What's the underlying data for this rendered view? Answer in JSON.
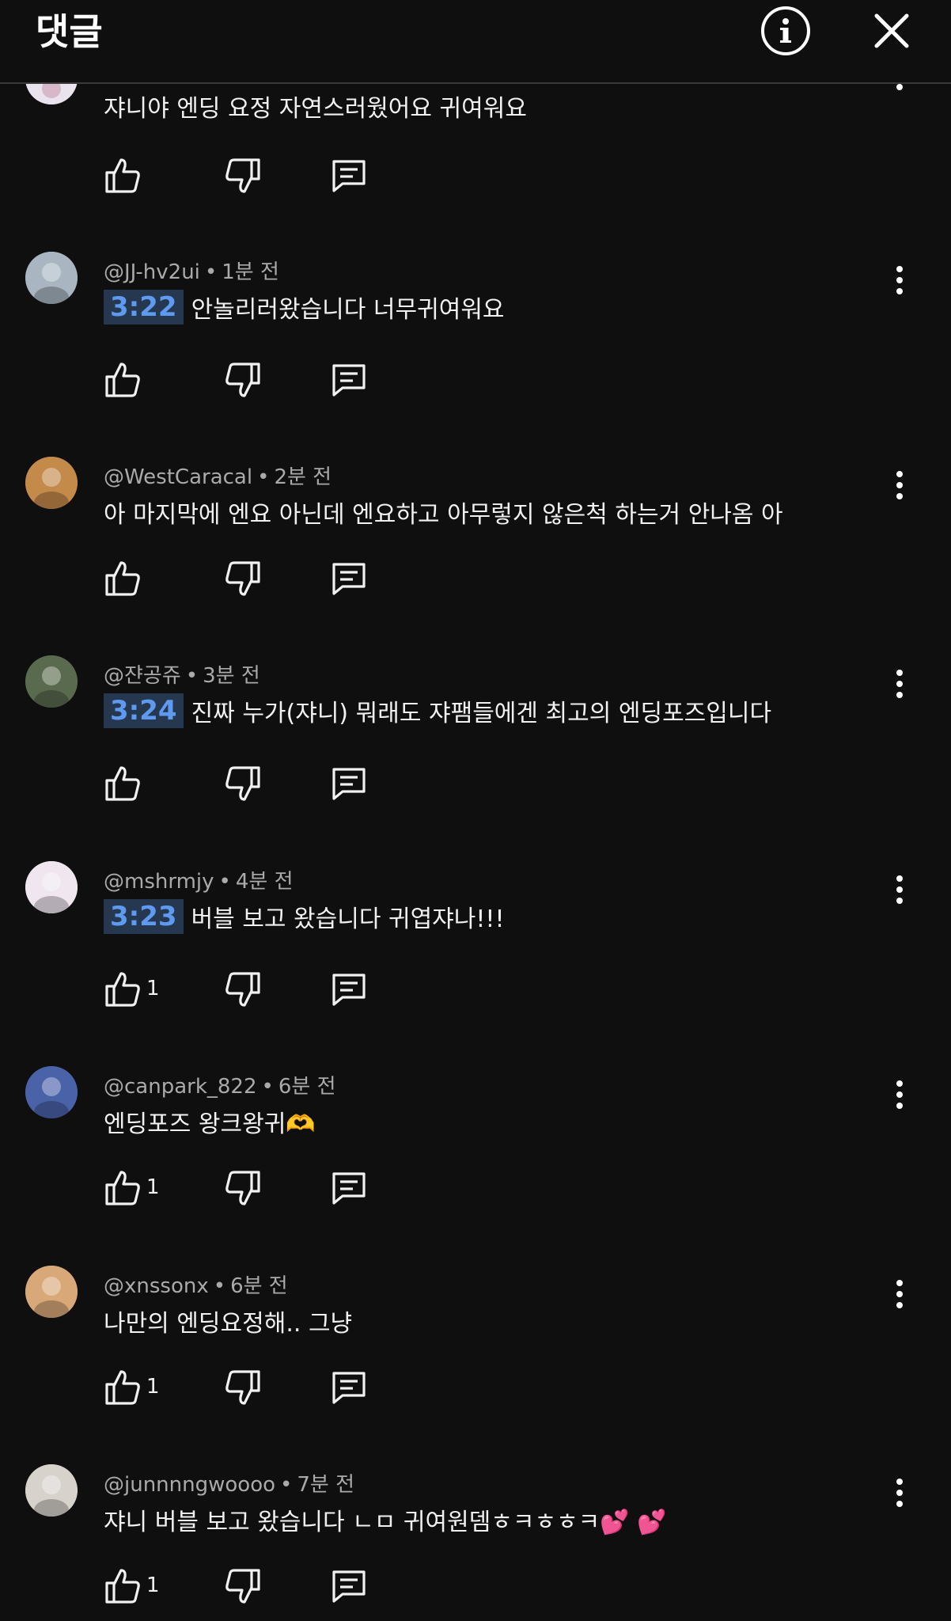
{
  "header": {
    "title": "댓글"
  },
  "top_partial": {
    "text": "쟈니야 엔딩 요정 자연스러웠어요 귀여워요"
  },
  "comments": [
    {
      "handle": "@JJ-hv2ui",
      "time": "1분 전",
      "timestamp": "3:22",
      "text": "안놀리러왔습니다 너무귀여워요",
      "likes": ""
    },
    {
      "handle": "@WestCaracal",
      "time": "2분 전",
      "timestamp": "",
      "text": "아 마지막에 엔요 아닌데 엔요하고 아무렇지 않은척 하는거 안나옴 아",
      "likes": ""
    },
    {
      "handle": "@쟌공쥬",
      "time": "3분 전",
      "timestamp": "3:24",
      "text": "진짜 누가(쟈니) 뭐래도 쟈팸들에겐 최고의 엔딩포즈입니다",
      "likes": ""
    },
    {
      "handle": "@mshrmjy",
      "time": "4분 전",
      "timestamp": "3:23",
      "text": "버블 보고 왔습니다 귀엽쟈나!!!",
      "likes": "1"
    },
    {
      "handle": "@canpark_822",
      "time": "6분 전",
      "timestamp": "",
      "text": "엔딩포즈 왕크왕귀🫶",
      "likes": "1"
    },
    {
      "handle": "@xnssonx",
      "time": "6분 전",
      "timestamp": "",
      "text": "나만의 엔딩요정해.. 그냥",
      "likes": "1"
    },
    {
      "handle": "@junnnngwoooo",
      "time": "7분 전",
      "timestamp": "",
      "text": "쟈니 버블 보고 왔습니다 ㄴㅁ 귀여원뎀ㅎㅋㅎㅎㅋ💕 💕",
      "likes": "1"
    }
  ],
  "icons": {
    "info": "info-icon",
    "close": "close-icon",
    "like": "thumbs-up-icon",
    "dislike": "thumbs-down-icon",
    "reply": "reply-icon",
    "more": "more-vert-icon"
  },
  "colors": {
    "background": "#0f0f0f",
    "timestamp_text": "#5e9bf0",
    "timestamp_bg": "#263850",
    "meta": "#aaaaaa"
  }
}
